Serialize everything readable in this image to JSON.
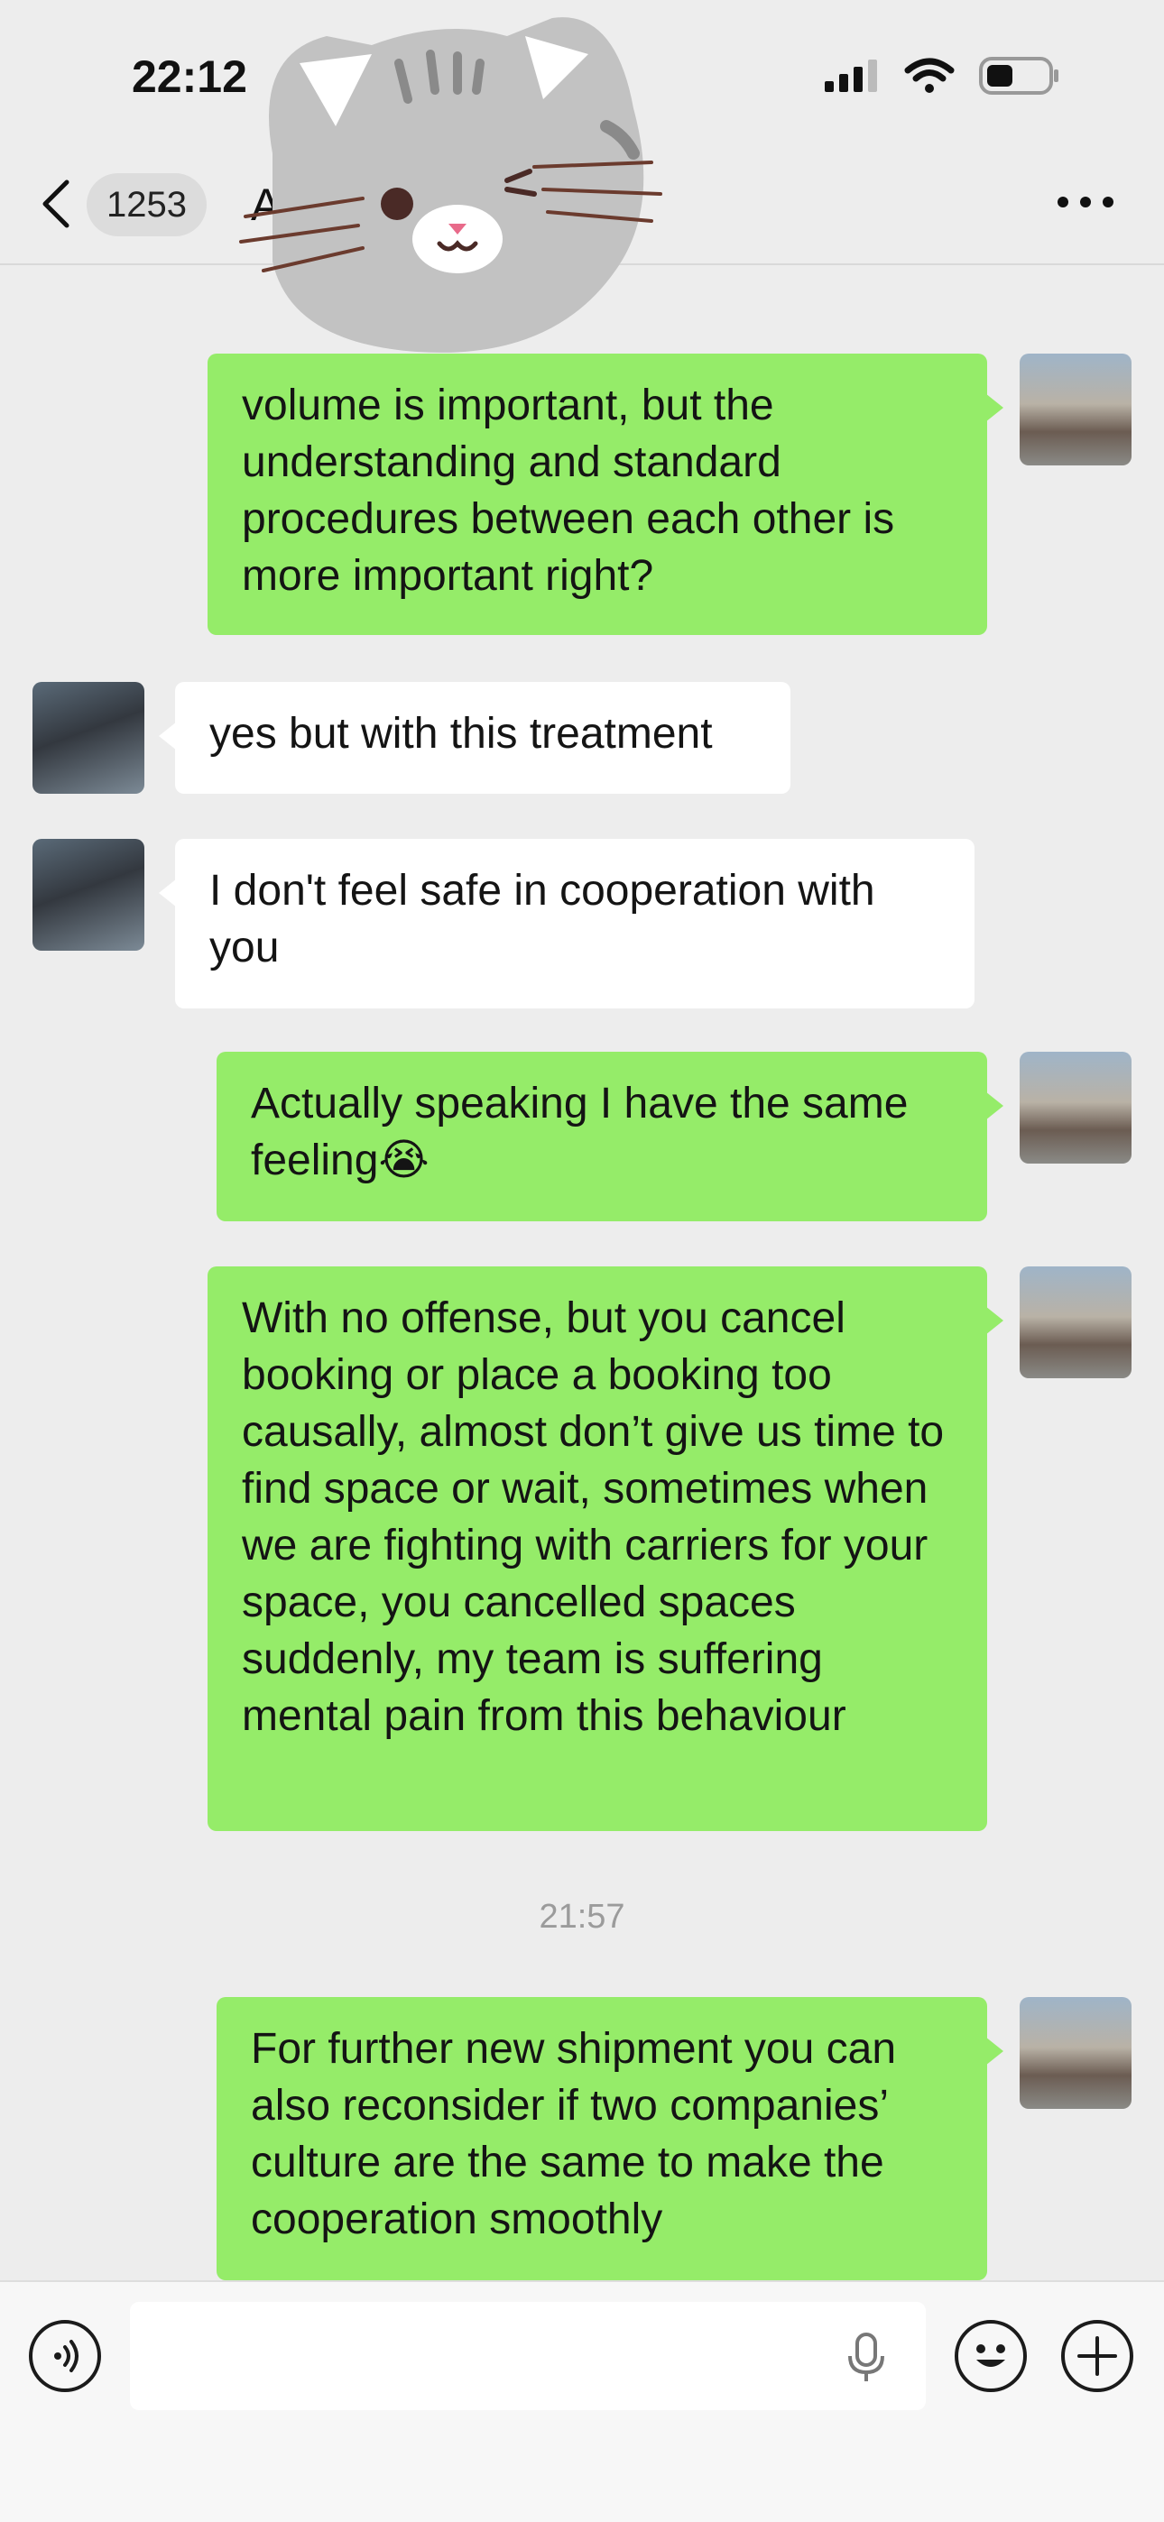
{
  "status_bar": {
    "time": "22:12"
  },
  "nav": {
    "unread_count": "1253",
    "title": "A                     ansport & Logi"
  },
  "messages": [
    {
      "sender": "me",
      "text": "volume is important, but the understanding and standard procedures between each other is more important right?"
    },
    {
      "sender": "them",
      "text": "yes but with this treatment"
    },
    {
      "sender": "them",
      "text": "I don't feel safe in cooperation with you"
    },
    {
      "sender": "me",
      "text": "Actually speaking I have the same feeling😭"
    },
    {
      "sender": "me",
      "text": "With no offense, but you cancel booking or place a booking too causally, almost don’t give us time to find space or wait, sometimes when we are fighting with carriers for your space, you cancelled spaces suddenly, my team is suffering mental pain from this behaviour"
    },
    {
      "sender": "timestamp",
      "text": "21:57"
    },
    {
      "sender": "me",
      "text": "For further new shipment you can also reconsider if two companies’ culture are the same to make the cooperation smoothly"
    }
  ],
  "input": {
    "placeholder": ""
  },
  "colors": {
    "my_bubble": "#95ec69",
    "their_bubble": "#ffffff",
    "background": "#ededed"
  },
  "icons": [
    "back-chevron-icon",
    "more-icon",
    "voice-icon",
    "microphone-icon",
    "emoji-icon",
    "plus-icon",
    "cat-sticker"
  ]
}
